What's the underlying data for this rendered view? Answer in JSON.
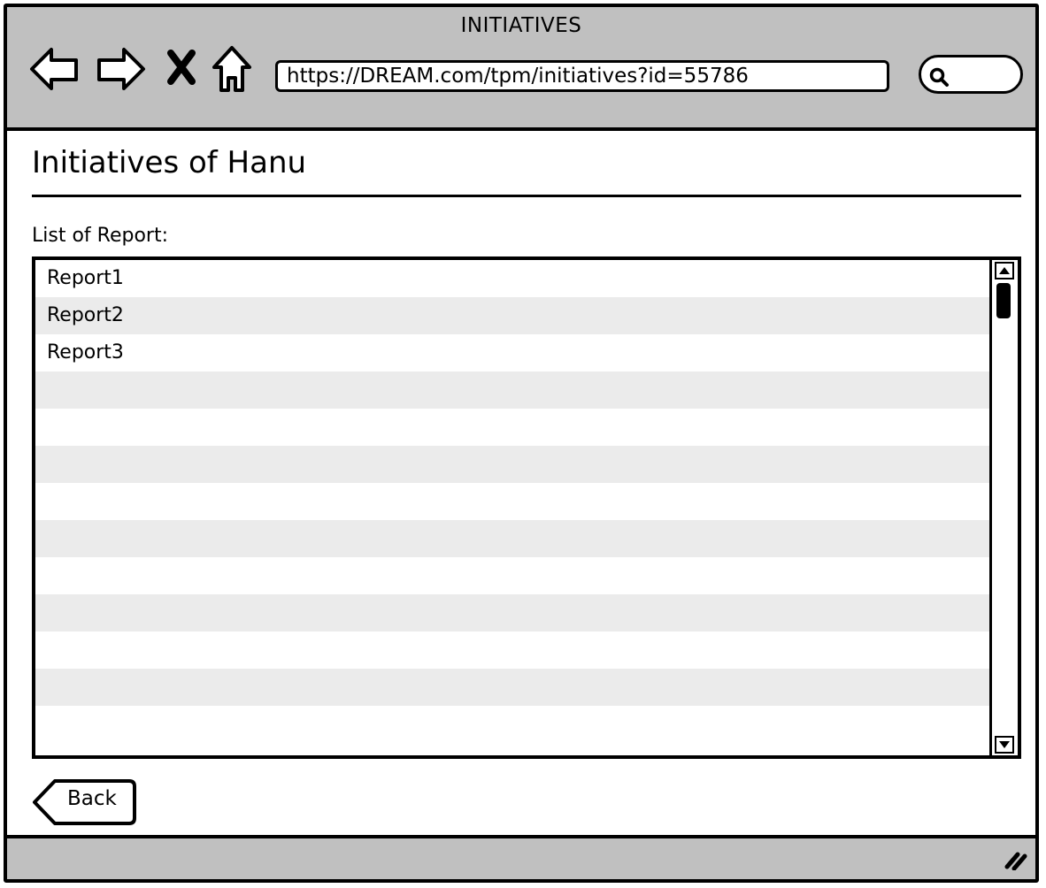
{
  "window": {
    "title": "INITIATIVES"
  },
  "browser": {
    "url": "https://DREAM.com/tpm/initiatives?id=55786",
    "icons": [
      "back-arrow-icon",
      "forward-arrow-icon",
      "close-icon",
      "home-icon",
      "search-icon"
    ]
  },
  "page": {
    "title": "Initiatives of Hanu",
    "list_label": "List of Report:",
    "reports": [
      "Report1",
      "Report2",
      "Report3",
      "",
      "",
      "",
      "",
      "",
      "",
      "",
      "",
      "",
      ""
    ]
  },
  "actions": {
    "back_label": "Back"
  }
}
